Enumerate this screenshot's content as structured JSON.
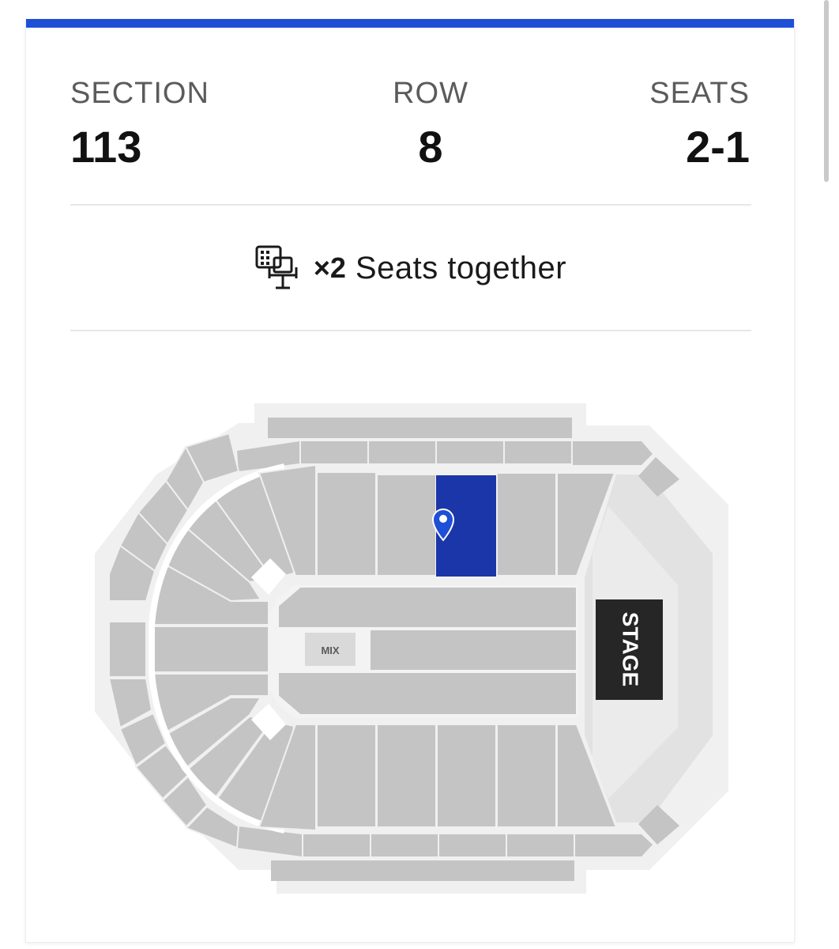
{
  "ticket": {
    "section_label": "SECTION",
    "section_value": "113",
    "row_label": "ROW",
    "row_value": "8",
    "seats_label": "SEATS",
    "seats_value": "2-1"
  },
  "together": {
    "icon": "seats-together-icon",
    "quantity": "×2",
    "text": "Seats together"
  },
  "map": {
    "selected_section": "113",
    "mix_label": "MIX",
    "stage_label": "STAGE",
    "selected_color": "#1a36a8",
    "section_color": "#c4c4c4",
    "accent_color": "#1e4fd6"
  }
}
